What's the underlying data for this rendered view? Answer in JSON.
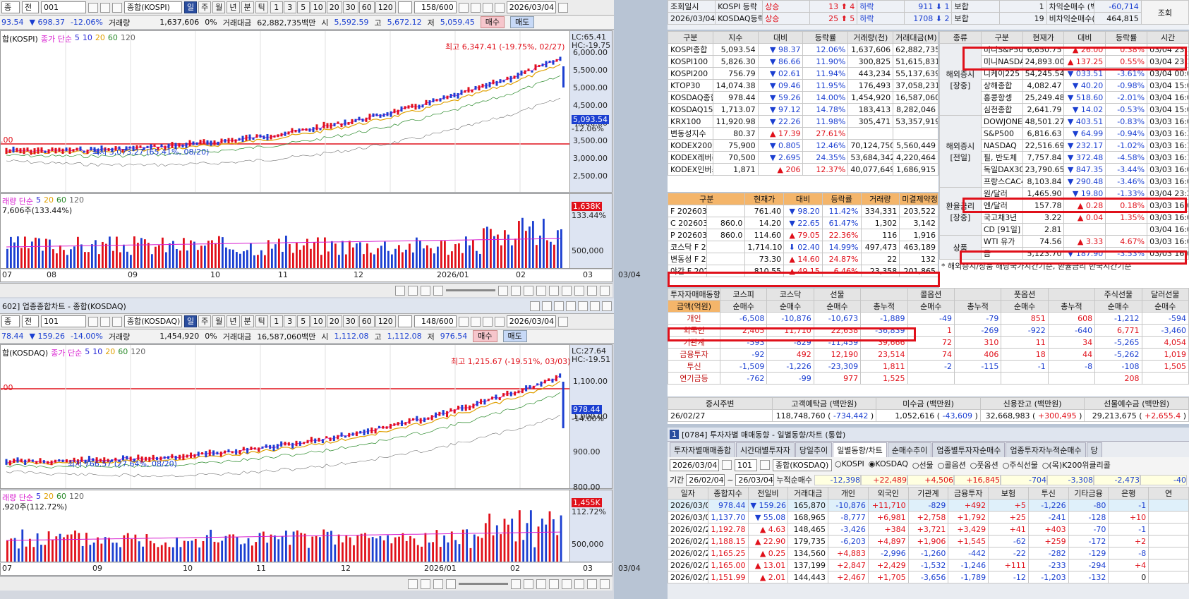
{
  "top_left": {
    "toolbar": {
      "cat": "종",
      "all": "전",
      "code": "001",
      "name": "종합(KOSPI)",
      "periods": [
        "일",
        "주",
        "월",
        "년",
        "분",
        "틱"
      ],
      "intervals": [
        "1",
        "3",
        "5",
        "10",
        "20",
        "30",
        "60",
        "120"
      ],
      "count": "158/600",
      "date": "2026/03/04"
    },
    "quote": {
      "price": "93.54",
      "chg": "▼ 698.37",
      "pct": "-12.06%",
      "vol_label": "거래량",
      "vol": "1,637,606",
      "zero": "0%",
      "amt_label": "거래대금",
      "amt": "62,882,735백만",
      "o_label": "시",
      "o": "5,592.59",
      "h_label": "고",
      "h": "5,672.12",
      "l_label": "저",
      "l": "5,059.45",
      "buy": "매수",
      "sell": "매도"
    },
    "legend": "합(KOSPI)",
    "ma": {
      "label": "종가 단순",
      "p5": "5",
      "p10": "10",
      "p20": "20",
      "p60": "60",
      "p120": "120"
    },
    "lc": "LC:65.41",
    "hc": "HC:-19.75",
    "high": "최고 6,347.41 (-19.75%, 02/27)",
    "low": "최저 3,073.27 (65.41%, 08/20)",
    "left_price": ".00",
    "cur": "5,093.54",
    "cur_pct": "-12.06%",
    "yticks": [
      "6,000.00",
      "5,500.00",
      "5,000.00",
      "4,500.00",
      "4,000.00",
      "3,500.00",
      "3,000.00",
      "2,500.00"
    ],
    "vol_legend": "래량  단순",
    "vol_ma": {
      "p5": "5",
      "p20": "20",
      "p60": "60",
      "p120": "120"
    },
    "vol_sub": "7,606주(133.44%)",
    "vol_cur": "1,638K",
    "vol_cur_pct": "133.44%",
    "vol_tick": "500,000",
    "xticks": [
      "07",
      "08",
      "09",
      "10",
      "11",
      "12",
      "2026/01",
      "02",
      "03",
      "03/04"
    ]
  },
  "bot_left": {
    "title": "602] 업종종합차트 - 종합(KOSDAQ)",
    "toolbar": {
      "cat": "종",
      "all": "전",
      "code": "101",
      "name": "종합(KOSDAQ)",
      "periods": [
        "일",
        "주",
        "월",
        "년",
        "분",
        "틱"
      ],
      "intervals": [
        "1",
        "3",
        "5",
        "10",
        "20",
        "30",
        "60",
        "120"
      ],
      "count": "148/600",
      "date": "2026/03/04"
    },
    "quote": {
      "price": "78.44",
      "chg": "▼ 159.26",
      "pct": "-14.00%",
      "vol_label": "거래량",
      "vol": "1,454,920",
      "zero": "0%",
      "amt_label": "거래대금",
      "amt": "16,587,060백만",
      "o_label": "시",
      "o": "1,112.08",
      "h_label": "고",
      "h": "1,112.08",
      "l_label": "저",
      "l": "976.54",
      "buy": "매수",
      "sell": "매도"
    },
    "legend": "합(KOSDAQ)",
    "ma": {
      "label": "종가 단순",
      "p5": "5",
      "p10": "10",
      "p20": "20",
      "p60": "60",
      "p120": "120"
    },
    "lc": "LC:27.64",
    "hc": "HC:-19.51",
    "high": "최고 1,215.67 (-19.51%, 03/03)",
    "low": "최저 766.57 (27.64%, 08/20)",
    "left_price": ".00",
    "cur": "978.44",
    "cur_pct": "-14.00%",
    "yticks": [
      "1,100.00",
      "1,000.00",
      "900.00",
      "800.00"
    ],
    "vol_legend": "래량  단순",
    "vol_ma": {
      "p5": "5",
      "p20": "20",
      "p60": "60",
      "p120": "120"
    },
    "vol_sub": ",920주(112.72%)",
    "vol_cur": "1,455K",
    "vol_cur_pct": "112.72%",
    "vol_tick": "500,000",
    "xticks": [
      "07",
      "09",
      "10",
      "11",
      "12",
      "2026/01",
      "02",
      "03",
      "03/04"
    ]
  },
  "right_top": {
    "rows": [
      {
        "lab": "조회일시",
        "name": "KOSPI 등락",
        "up_lab": "상승",
        "up": "13",
        "up2": "4",
        "dn_lab": "하락",
        "dn": "911",
        "dn2": "1",
        "flat_lab": "보합",
        "flat": "1",
        "k": "차익순매수 (백만)",
        "v": "-60,714"
      },
      {
        "lab": "2026/03/04",
        "name": "KOSDAQ등락",
        "up_lab": "상승",
        "up": "25",
        "up2": "5",
        "dn_lab": "하락",
        "dn": "1708",
        "dn2": "2",
        "flat_lab": "보합",
        "flat": "19",
        "k": "비차익순매수(백만)",
        "v": "464,815"
      }
    ],
    "query": "조회"
  },
  "index_table": {
    "headers": [
      "구분",
      "지수",
      "대비",
      "등락률",
      "거래량(천)",
      "거래대금(M)"
    ],
    "rows": [
      [
        "KOSPI종합",
        "5,093.54",
        "▼ 98.37",
        "12.06%",
        "1,637,606",
        "62,882,735"
      ],
      [
        "KOSPI100",
        "5,826.30",
        "▼ 86.66",
        "11.90%",
        "300,825",
        "51,615,831"
      ],
      [
        "KOSPI200",
        "756.79",
        "▼ 02.61",
        "11.94%",
        "443,234",
        "55,137,639"
      ],
      [
        "KTOP30",
        "14,074.38",
        "▼ 09.46",
        "11.95%",
        "176,493",
        "37,058,231"
      ],
      [
        "KOSDAQ종합",
        "978.44",
        "▼ 59.26",
        "14.00%",
        "1,454,920",
        "16,587,060"
      ],
      [
        "KOSDAQ150",
        "1,713.07",
        "▼ 97.12",
        "14.78%",
        "183,413",
        "8,282,046"
      ],
      [
        "KRX100",
        "11,920.98",
        "▼ 22.26",
        "11.98%",
        "305,471",
        "53,357,919"
      ],
      [
        "변동성지수",
        "80.37",
        "▲ 17.39",
        "27.61%",
        "",
        ""
      ],
      [
        "KODEX200",
        "75,900",
        "▼ 0.805",
        "12.46%",
        "70,124,750",
        "5,560,449"
      ],
      [
        "KODEX레버리지",
        "70,500",
        "▼ 2.695",
        "24.35%",
        "53,684,342",
        "4,220,464"
      ],
      [
        "KODEX인버스",
        "1,871",
        "▲ 206",
        "12.37%",
        "40,077,649",
        "1,686,915"
      ]
    ]
  },
  "fut_table": {
    "headers": [
      "구분",
      "현재가",
      "대비",
      "등락률",
      "거래량",
      "미결제약정"
    ],
    "rows": [
      [
        "F 202603",
        "",
        "761.40",
        "▼ 98.20",
        "11.42%",
        "334,331",
        "203,522"
      ],
      [
        "C 202603",
        "860.0",
        "14.20",
        "▼ 22.65",
        "61.47%",
        "1,302",
        "3,142"
      ],
      [
        "P 202603",
        "860.0",
        "114.60",
        "▲ 79.05",
        "22.36%",
        "116",
        "1,916"
      ],
      [
        "코스닥 F 202603",
        "",
        "1,714.10",
        "⬇ 02.40",
        "14.99%",
        "497,473",
        "463,189"
      ],
      [
        "변동성 F 202603",
        "",
        "73.30",
        "▲ 14.60",
        "24.87%",
        "22",
        "132"
      ],
      [
        "야간 F 202603",
        "",
        "810.55",
        "▲ 49.15",
        "6.46%",
        "23,358",
        "201,865"
      ]
    ]
  },
  "world_table": {
    "headers": [
      "종류",
      "구분",
      "현재가",
      "대비",
      "등락률",
      "시간"
    ],
    "groups": [
      "해외증시[장중]",
      "해외증시[전일]",
      "환율금리[장중]",
      "상품"
    ],
    "rows": [
      [
        "미니S&P500",
        "6,850.75",
        "▲ 26.00",
        "0.38%",
        "03/04 23:17"
      ],
      [
        "미니NASDAQ",
        "24,893.00",
        "▲ 137.25",
        "0.55%",
        "03/04 23:17"
      ],
      [
        "니케이225",
        "54,245.54",
        "▼ 033.51",
        "-3.61%",
        "03/04 00:00"
      ],
      [
        "상해종합",
        "4,082.47",
        "▼ 40.20",
        "-0.98%",
        "03/04 15:00"
      ],
      [
        "홍콩항셍",
        "25,249.48",
        "▼ 518.60",
        "-2.01%",
        "03/04 16:08"
      ],
      [
        "심천종합",
        "2,641.79",
        "▼ 14.02",
        "-0.53%",
        "03/04 15:00"
      ],
      [
        "DOWJONES",
        "48,501.27",
        "▼ 403.51",
        "-0.83%",
        "03/03 16:00"
      ],
      [
        "S&P500",
        "6,816.63",
        "▼ 64.99",
        "-0.94%",
        "03/03 16:34"
      ],
      [
        "NASDAQ",
        "22,516.69",
        "▼ 232.17",
        "-1.02%",
        "03/03 16:15"
      ],
      [
        "필, 반도체",
        "7,757.84",
        "▼ 372.48",
        "-4.58%",
        "03/03 16:15"
      ],
      [
        "독일DAX30",
        "23,790.65",
        "▼ 847.35",
        "-3.44%",
        "03/03 16:00"
      ],
      [
        "프랑스CAC40",
        "8,103.84",
        "▼ 290.48",
        "-3.46%",
        "03/03 16:00"
      ],
      [
        "원/달러",
        "1,465.90",
        "▼ 19.80",
        "-1.33%",
        "03/04 23:21"
      ],
      [
        "엔/달러",
        "157.78",
        "▲ 0.28",
        "0.18%",
        "03/03 16:00"
      ],
      [
        "국고채3년",
        "3.22",
        "▲ 0.04",
        "1.35%",
        "03/03 16:00"
      ],
      [
        "CD [91일]",
        "2.81",
        "",
        "",
        "03/04 16:00"
      ],
      [
        "WTI 유가",
        "74.56",
        "▲ 3.33",
        "4.67%",
        "03/03 16:00"
      ],
      [
        "금",
        "5,123.70",
        "▼ 187.90",
        "-3.53%",
        "03/03 16:00"
      ]
    ],
    "note": "* 해외증시/상품 해당국가시간기준, 환율금리 한국시간기준"
  },
  "investor": {
    "title": "투자자매매동향",
    "unit": "금액(억원)",
    "cols": [
      "코스피",
      "코스닥",
      "선물",
      "",
      "콜옵션",
      "",
      "풋옵션",
      "",
      "주식선물",
      "달러선물"
    ],
    "sub": [
      "순매수",
      "순매수",
      "순매수",
      "총누적",
      "순매수",
      "총누적",
      "순매수",
      "총누적",
      "순매수",
      "순매수"
    ],
    "rows": [
      {
        "name": "개인",
        "v": [
          "-6,508",
          "-10,876",
          "-10,673",
          "-1,889",
          "-49",
          "-79",
          "851",
          "608",
          "-1,212",
          "-594"
        ]
      },
      {
        "name": "외국인",
        "v": [
          "2,405",
          "11,710",
          "22,638",
          "-36,839",
          "1",
          "-269",
          "-922",
          "-640",
          "6,771",
          "-3,460"
        ]
      },
      {
        "name": "기관계",
        "v": [
          "-593",
          "-829",
          "-11,459",
          "39,666",
          "72",
          "310",
          "11",
          "34",
          "-5,265",
          "4,054"
        ]
      },
      {
        "name": "금융투자",
        "v": [
          "-92",
          "492",
          "12,190",
          "23,514",
          "74",
          "406",
          "18",
          "44",
          "-5,262",
          "1,019"
        ]
      },
      {
        "name": "투신",
        "v": [
          "-1,509",
          "-1,226",
          "-23,309",
          "1,811",
          "-2",
          "-115",
          "-1",
          "-8",
          "-108",
          "1,505"
        ]
      },
      {
        "name": "연기금등",
        "v": [
          "-762",
          "-99",
          "977",
          "1,525",
          "",
          "",
          "",
          "",
          "208",
          ""
        ]
      }
    ]
  },
  "deposit": {
    "headers": [
      "증시주변",
      "고객예탁금 (백만원)",
      "미수금 (백만원)",
      "신용잔고 (백만원)",
      "선물예수금 (백만원)"
    ],
    "date": "26/02/27",
    "v1": "118,748,760",
    "d1": "-734,442",
    "v2": "1,052,616",
    "d2": "-43,609",
    "v3": "32,668,983",
    "d3": "+300,495",
    "v4": "29,213,675",
    "d4": "+2,655.4"
  },
  "daily": {
    "title": "[0784] 투자자별 매매동향 - 일별동향/차트 (통합)",
    "tabs": [
      "투자자별매매종합",
      "시간대별투자자",
      "당일추이",
      "일별동향/차트",
      "순매수추이",
      "업종별투자자순매수",
      "업종투자자누적순매수",
      "당"
    ],
    "date": "2026/03/04",
    "code": "101",
    "name": "종합(KOSDAQ)",
    "radios": [
      "KOSPI",
      "KOSDAQ",
      "선물",
      "콜옵션",
      "풋옵션",
      "주식선물",
      "(목)K200위클리콜"
    ],
    "period_label": "기간",
    "from": "26/02/04",
    "to": "26/03/04",
    "cum_label": "누적순매수",
    "cum": [
      "-12,398",
      "+22,489",
      "+4,506",
      "+16,845",
      "-704",
      "-3,308",
      "-2,473",
      "-40"
    ],
    "headers": [
      "일자",
      "종합지수",
      "전일비",
      "거래대금",
      "개인",
      "외국인",
      "기관계",
      "금융투자",
      "보험",
      "투신",
      "기타금융",
      "은행",
      "연"
    ],
    "rows": [
      [
        "2026/03/04",
        "978.44",
        "▼ 159.26",
        "165,870",
        "-10,876",
        "+11,710",
        "-829",
        "+492",
        "+5",
        "-1,226",
        "-80",
        "-1",
        ""
      ],
      [
        "2026/03/03",
        "1,137.70",
        "▼ 55.08",
        "168,965",
        "-8,777",
        "+6,981",
        "+2,758",
        "+1,792",
        "+25",
        "-241",
        "-128",
        "+10",
        ""
      ],
      [
        "2026/02/27",
        "1,192.78",
        "▲ 4.63",
        "148,465",
        "-3,426",
        "+384",
        "+3,721",
        "+3,429",
        "+41",
        "+403",
        "-70",
        "-1",
        ""
      ],
      [
        "2026/02/26",
        "1,188.15",
        "▲ 22.90",
        "179,735",
        "-6,203",
        "+4,897",
        "+1,906",
        "+1,545",
        "-62",
        "+259",
        "-172",
        "+2",
        ""
      ],
      [
        "2026/02/25",
        "1,165.25",
        "▲ 0.25",
        "134,560",
        "+4,883",
        "-2,996",
        "-1,260",
        "-442",
        "-22",
        "-282",
        "-129",
        "-8",
        ""
      ],
      [
        "2026/02/24",
        "1,165.00",
        "▲ 13.01",
        "137,199",
        "+2,847",
        "+2,429",
        "-1,532",
        "-1,246",
        "+111",
        "-233",
        "-294",
        "+4",
        ""
      ],
      [
        "2026/02/23",
        "1,151.99",
        "▲ 2.01",
        "144,443",
        "+2,467",
        "+1,705",
        "-3,656",
        "-1,789",
        "-12",
        "-1,203",
        "-132",
        "0",
        ""
      ]
    ]
  },
  "colors": {
    "up": "#e0101a",
    "down": "#1b3fd1",
    "ma5": "#d81fd0",
    "ma10": "#2a2ad8",
    "ma20": "#e0a000",
    "ma60": "#2a8a2a",
    "ma120": "#666666",
    "accent": "#2a4d9e"
  }
}
